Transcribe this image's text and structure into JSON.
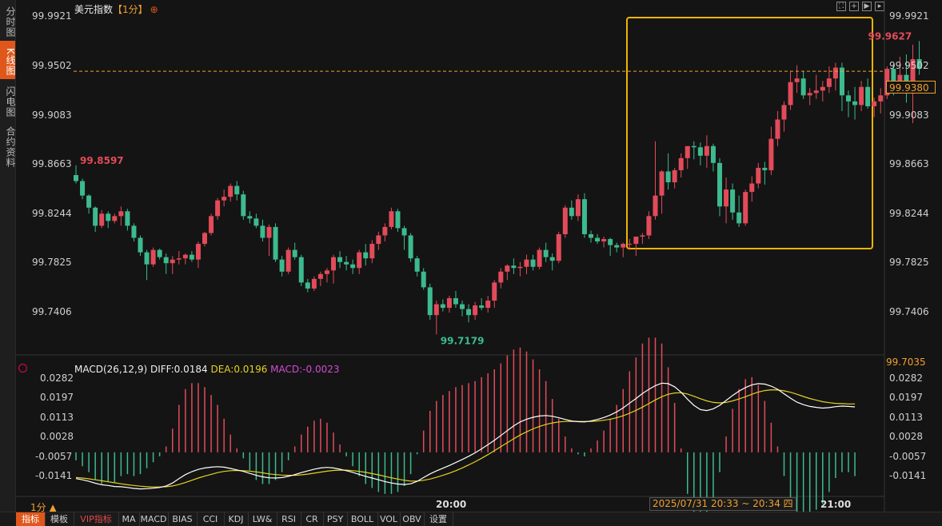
{
  "sidebar": [
    {
      "label": "分时图",
      "active": false
    },
    {
      "label": "K线图",
      "active": true
    },
    {
      "label": "闪电图",
      "active": false
    },
    {
      "label": "合约资料",
      "active": false
    }
  ],
  "title": {
    "name": "美元指数",
    "period": "【1分】",
    "add_icon": "⊕"
  },
  "toolbar_icons": [
    "fullscreen-icon",
    "crosshair-icon",
    "play-icon",
    "forward-icon"
  ],
  "price_axis": [
    "99.9921",
    "99.9502",
    "99.9083",
    "99.8663",
    "99.8244",
    "99.7825",
    "99.7406"
  ],
  "current_price": "99.9380",
  "separator_value": "99.7035",
  "markers": {
    "start": "99.8597",
    "low": "99.7179",
    "high": "99.9627"
  },
  "macd": {
    "title": "MACD(26,12,9)",
    "diff_label": "DIFF:0.0184",
    "dea_label": "DEA:0.0196",
    "macd_label": "MACD:-0.0023",
    "axis": [
      "0.0282",
      "0.0197",
      "0.0113",
      "0.0028",
      "-0.0057",
      "-0.0141"
    ]
  },
  "time_axis": [
    "20:00",
    "21:00"
  ],
  "period_label": "1分 ▲",
  "cursor_time": "2025/07/31 20:33 ~ 20:34 四",
  "tabs": [
    "指标",
    "模板",
    "VIP指标",
    "MA",
    "MACD",
    "BIAS",
    "CCI",
    "KDJ",
    "LW&",
    "RSI",
    "CR",
    "PSY",
    "BOLL",
    "VOL",
    "OBV",
    "设置"
  ],
  "colors": {
    "up": "#e24b5a",
    "down": "#3dba8e",
    "accent": "#e0571b",
    "highlight_box": "#f0b400",
    "diff": "#ffffff",
    "dea": "#e6d21e"
  },
  "chart_data": {
    "type": "candlestick",
    "ylim": [
      99.703,
      99.997
    ],
    "x_ticks": [
      {
        "index": 47,
        "label": "20:00"
      },
      {
        "index": 107,
        "label": "21:00"
      }
    ],
    "candles": [
      [
        99.852,
        99.86,
        99.845,
        99.847
      ],
      [
        99.847,
        99.849,
        99.832,
        99.835
      ],
      [
        99.835,
        99.836,
        99.82,
        99.825
      ],
      [
        99.825,
        99.826,
        99.805,
        99.81
      ],
      [
        99.81,
        99.823,
        99.808,
        99.82
      ],
      [
        99.82,
        99.822,
        99.808,
        99.814
      ],
      [
        99.814,
        99.82,
        99.812,
        99.818
      ],
      [
        99.818,
        99.826,
        99.81,
        99.822
      ],
      [
        99.822,
        99.824,
        99.806,
        99.81
      ],
      [
        99.81,
        99.812,
        99.797,
        99.8
      ],
      [
        99.8,
        99.802,
        99.785,
        99.788
      ],
      [
        99.788,
        99.79,
        99.765,
        99.778
      ],
      [
        99.778,
        99.792,
        99.776,
        99.79
      ],
      [
        99.79,
        99.791,
        99.782,
        99.784
      ],
      [
        99.784,
        99.787,
        99.77,
        99.779
      ],
      [
        99.779,
        99.785,
        99.77,
        99.782
      ],
      [
        99.782,
        99.789,
        99.778,
        99.783
      ],
      [
        99.783,
        99.787,
        99.778,
        99.786
      ],
      [
        99.786,
        99.789,
        99.78,
        99.782
      ],
      [
        99.782,
        99.797,
        99.775,
        99.795
      ],
      [
        99.795,
        99.805,
        99.793,
        99.804
      ],
      [
        99.804,
        99.82,
        99.802,
        99.818
      ],
      [
        99.818,
        99.833,
        99.815,
        99.831
      ],
      [
        99.831,
        99.84,
        99.826,
        99.834
      ],
      [
        99.834,
        99.845,
        99.83,
        99.843
      ],
      [
        99.843,
        99.847,
        99.831,
        99.836
      ],
      [
        99.836,
        99.839,
        99.815,
        99.818
      ],
      [
        99.818,
        99.822,
        99.812,
        99.816
      ],
      [
        99.816,
        99.82,
        99.808,
        99.81
      ],
      [
        99.81,
        99.815,
        99.797,
        99.8
      ],
      [
        99.8,
        99.811,
        99.785,
        99.809
      ],
      [
        99.809,
        99.812,
        99.78,
        99.782
      ],
      [
        99.782,
        99.785,
        99.768,
        99.772
      ],
      [
        99.772,
        99.792,
        99.77,
        99.79
      ],
      [
        99.79,
        99.796,
        99.782,
        99.784
      ],
      [
        99.784,
        99.786,
        99.76,
        99.763
      ],
      [
        99.763,
        99.766,
        99.755,
        99.758
      ],
      [
        99.758,
        99.768,
        99.756,
        99.766
      ],
      [
        99.766,
        99.772,
        99.76,
        99.77
      ],
      [
        99.77,
        99.775,
        99.763,
        99.773
      ],
      [
        99.773,
        99.786,
        99.762,
        99.784
      ],
      [
        99.784,
        99.789,
        99.775,
        99.78
      ],
      [
        99.78,
        99.785,
        99.773,
        99.778
      ],
      [
        99.778,
        99.782,
        99.77,
        99.775
      ],
      [
        99.775,
        99.79,
        99.77,
        99.788
      ],
      [
        99.788,
        99.795,
        99.777,
        99.783
      ],
      [
        99.783,
        99.798,
        99.779,
        99.795
      ],
      [
        99.795,
        99.805,
        99.79,
        99.802
      ],
      [
        99.802,
        99.812,
        99.797,
        99.809
      ],
      [
        99.809,
        99.825,
        99.807,
        99.822
      ],
      [
        99.822,
        99.824,
        99.805,
        99.808
      ],
      [
        99.808,
        99.81,
        99.79,
        99.802
      ],
      [
        99.802,
        99.804,
        99.78,
        99.783
      ],
      [
        99.783,
        99.785,
        99.768,
        99.772
      ],
      [
        99.772,
        99.775,
        99.757,
        99.759
      ],
      [
        99.759,
        99.762,
        99.732,
        99.736
      ],
      [
        99.736,
        99.748,
        99.72,
        99.745
      ],
      [
        99.745,
        99.749,
        99.739,
        99.742
      ],
      [
        99.742,
        99.752,
        99.738,
        99.75
      ],
      [
        99.75,
        99.756,
        99.742,
        99.745
      ],
      [
        99.745,
        99.748,
        99.735,
        99.741
      ],
      [
        99.741,
        99.745,
        99.73,
        99.736
      ],
      [
        99.736,
        99.747,
        99.732,
        99.744
      ],
      [
        99.744,
        99.75,
        99.74,
        99.742
      ],
      [
        99.742,
        99.752,
        99.738,
        99.748
      ],
      [
        99.748,
        99.765,
        99.742,
        99.763
      ],
      [
        99.763,
        99.775,
        99.758,
        99.772
      ],
      [
        99.772,
        99.778,
        99.765,
        99.777
      ],
      [
        99.777,
        99.783,
        99.77,
        99.775
      ],
      [
        99.775,
        99.78,
        99.768,
        99.776
      ],
      [
        99.776,
        99.786,
        99.77,
        99.782
      ],
      [
        99.782,
        99.786,
        99.773,
        99.776
      ],
      [
        99.776,
        99.792,
        99.774,
        99.79
      ],
      [
        99.79,
        99.796,
        99.78,
        99.784
      ],
      [
        99.784,
        99.787,
        99.773,
        99.781
      ],
      [
        99.781,
        99.805,
        99.779,
        99.803
      ],
      [
        99.803,
        99.827,
        99.8,
        99.825
      ],
      [
        99.825,
        99.831,
        99.815,
        99.818
      ],
      [
        99.818,
        99.836,
        99.814,
        99.832
      ],
      [
        99.832,
        99.837,
        99.8,
        99.803
      ],
      [
        99.803,
        99.806,
        99.796,
        99.8
      ],
      [
        99.8,
        99.803,
        99.795,
        99.797
      ],
      [
        99.797,
        99.801,
        99.792,
        99.799
      ],
      [
        99.799,
        99.8,
        99.785,
        99.794
      ],
      [
        99.794,
        99.796,
        99.788,
        99.792
      ],
      [
        99.792,
        99.796,
        99.784,
        99.795
      ],
      [
        99.795,
        99.799,
        99.79,
        99.795
      ],
      [
        99.795,
        99.8,
        99.785,
        99.801
      ],
      [
        99.801,
        99.804,
        99.795,
        99.802
      ],
      [
        99.802,
        99.822,
        99.799,
        99.818
      ],
      [
        99.818,
        99.88,
        99.815,
        99.835
      ],
      [
        99.835,
        99.856,
        99.82,
        99.855
      ],
      [
        99.855,
        99.87,
        99.84,
        99.846
      ],
      [
        99.846,
        99.858,
        99.841,
        99.856
      ],
      [
        99.856,
        99.87,
        99.85,
        99.866
      ],
      [
        99.866,
        99.872,
        99.857,
        99.876
      ],
      [
        99.876,
        99.88,
        99.865,
        99.875
      ],
      [
        99.875,
        99.879,
        99.86,
        99.868
      ],
      [
        99.868,
        99.885,
        99.858,
        99.876
      ],
      [
        99.876,
        99.878,
        99.855,
        99.862
      ],
      [
        99.862,
        99.866,
        99.818,
        99.826
      ],
      [
        99.826,
        99.85,
        99.812,
        99.84
      ],
      [
        99.84,
        99.845,
        99.815,
        99.821
      ],
      [
        99.821,
        99.835,
        99.809,
        99.812
      ],
      [
        99.812,
        99.84,
        99.81,
        99.838
      ],
      [
        99.838,
        99.851,
        99.83,
        99.845
      ],
      [
        99.845,
        99.862,
        99.841,
        99.858
      ],
      [
        99.858,
        99.863,
        99.844,
        99.856
      ],
      [
        99.856,
        99.892,
        99.852,
        99.882
      ],
      [
        99.882,
        99.905,
        99.876,
        99.898
      ],
      [
        99.898,
        99.913,
        99.888,
        99.91
      ],
      [
        99.91,
        99.938,
        99.906,
        99.929
      ],
      [
        99.929,
        99.943,
        99.92,
        99.932
      ],
      [
        99.932,
        99.938,
        99.915,
        99.918
      ],
      [
        99.918,
        99.924,
        99.91,
        99.92
      ],
      [
        99.92,
        99.935,
        99.915,
        99.922
      ],
      [
        99.922,
        99.93,
        99.913,
        99.925
      ],
      [
        99.925,
        99.942,
        99.92,
        99.932
      ],
      [
        99.932,
        99.945,
        99.922,
        99.941
      ],
      [
        99.941,
        99.945,
        99.905,
        99.918
      ],
      [
        99.918,
        99.922,
        99.9,
        99.913
      ],
      [
        99.913,
        99.925,
        99.898,
        99.91
      ],
      [
        99.91,
        99.93,
        99.905,
        99.925
      ],
      [
        99.925,
        99.932,
        99.907,
        99.909
      ],
      [
        99.909,
        99.916,
        99.9,
        99.913
      ],
      [
        99.913,
        99.924,
        99.903,
        99.918
      ],
      [
        99.918,
        99.942,
        99.915,
        99.94
      ],
      [
        99.94,
        99.944,
        99.918,
        99.93
      ],
      [
        99.93,
        99.95,
        99.92,
        99.935
      ],
      [
        99.935,
        99.952,
        99.912,
        99.92
      ],
      [
        99.92,
        99.96,
        99.895,
        99.948
      ],
      [
        99.948,
        99.963,
        99.935,
        99.94
      ]
    ],
    "macd_diff": [
      -0.0106,
      -0.0111,
      -0.0117,
      -0.0125,
      -0.0131,
      -0.0134,
      -0.0138,
      -0.0139,
      -0.0142,
      -0.0146,
      -0.0148,
      -0.0147,
      -0.0145,
      -0.0142,
      -0.0136,
      -0.0124,
      -0.0106,
      -0.009,
      -0.0078,
      -0.0069,
      -0.0063,
      -0.006,
      -0.0058,
      -0.006,
      -0.0065,
      -0.0071,
      -0.0077,
      -0.0085,
      -0.0093,
      -0.0099,
      -0.0103,
      -0.0104,
      -0.0102,
      -0.0097,
      -0.009,
      -0.0082,
      -0.0075,
      -0.0068,
      -0.0063,
      -0.0061,
      -0.0063,
      -0.0068,
      -0.0074,
      -0.0081,
      -0.0089,
      -0.0097,
      -0.0104,
      -0.0111,
      -0.0118,
      -0.0124,
      -0.0128,
      -0.013,
      -0.0127,
      -0.0117,
      -0.0102,
      -0.0087,
      -0.0075,
      -0.0064,
      -0.0053,
      -0.0041,
      -0.0029,
      -0.0016,
      -0.0002,
      0.0014,
      0.0031,
      0.0049,
      0.0068,
      0.0088,
      0.0107,
      0.0123,
      0.0134,
      0.0142,
      0.0147,
      0.0149,
      0.0146,
      0.014,
      0.0133,
      0.0127,
      0.0124,
      0.0123,
      0.0127,
      0.0133,
      0.0141,
      0.0151,
      0.0164,
      0.018,
      0.0199,
      0.0218,
      0.0238,
      0.0255,
      0.027,
      0.028,
      0.0278,
      0.0265,
      0.0243,
      0.0215,
      0.019,
      0.0173,
      0.0169,
      0.0176,
      0.019,
      0.021,
      0.023,
      0.0248,
      0.0262,
      0.0273,
      0.0278,
      0.0276,
      0.0268,
      0.0255,
      0.0237,
      0.0219,
      0.0203,
      0.0193,
      0.0186,
      0.0182,
      0.0179,
      0.0181,
      0.0185,
      0.0187,
      0.0186,
      0.0184
    ],
    "macd_dea": [
      -0.0102,
      -0.0104,
      -0.0107,
      -0.0111,
      -0.0115,
      -0.0119,
      -0.0123,
      -0.0127,
      -0.0131,
      -0.0134,
      -0.0137,
      -0.0139,
      -0.014,
      -0.014,
      -0.0139,
      -0.0136,
      -0.013,
      -0.0122,
      -0.0113,
      -0.0104,
      -0.0096,
      -0.0089,
      -0.0082,
      -0.0077,
      -0.0074,
      -0.0073,
      -0.0074,
      -0.0076,
      -0.0079,
      -0.0083,
      -0.0087,
      -0.009,
      -0.0092,
      -0.0093,
      -0.0093,
      -0.0091,
      -0.0088,
      -0.0084,
      -0.008,
      -0.0076,
      -0.0073,
      -0.0072,
      -0.0072,
      -0.0074,
      -0.0077,
      -0.0081,
      -0.0086,
      -0.0091,
      -0.0097,
      -0.0103,
      -0.0108,
      -0.0113,
      -0.0116,
      -0.0116,
      -0.0113,
      -0.0108,
      -0.0101,
      -0.0093,
      -0.0084,
      -0.0074,
      -0.0063,
      -0.0051,
      -0.0038,
      -0.0024,
      -0.0009,
      0.0007,
      0.0023,
      0.0039,
      0.0055,
      0.007,
      0.0083,
      0.0095,
      0.0105,
      0.0113,
      0.0119,
      0.0123,
      0.0125,
      0.0125,
      0.0125,
      0.0125,
      0.0125,
      0.0127,
      0.013,
      0.0134,
      0.014,
      0.0148,
      0.0158,
      0.017,
      0.0183,
      0.0197,
      0.0212,
      0.0225,
      0.0235,
      0.024,
      0.0241,
      0.0236,
      0.0227,
      0.0217,
      0.0208,
      0.0202,
      0.02,
      0.0202,
      0.0208,
      0.0216,
      0.0225,
      0.0235,
      0.0244,
      0.025,
      0.0253,
      0.0252,
      0.0249,
      0.0243,
      0.0235,
      0.0226,
      0.0218,
      0.0211,
      0.0205,
      0.0201,
      0.0198,
      0.0197,
      0.0196,
      0.0196
    ]
  }
}
